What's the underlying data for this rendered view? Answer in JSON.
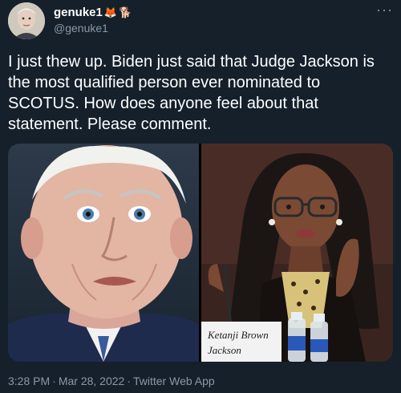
{
  "tweet": {
    "display_name": "genuke1",
    "name_emojis": [
      "fox-icon",
      "dog-icon"
    ],
    "handle": "@genuke1",
    "more_label": "···",
    "text": "I just thew up. Biden just said that Judge Jackson is the most qualified person ever nominated to SCOTUS. How does anyone feel about that statement. Please comment.",
    "photos": [
      {
        "id": "left",
        "subject": "man-face-photo"
      },
      {
        "id": "right",
        "subject": "woman-speaking-photo",
        "nameplate_line1": "Ketanji Brown",
        "nameplate_line2": "Jackson"
      }
    ],
    "time": "3:28 PM",
    "date": "Mar 28, 2022",
    "separator": "·",
    "source": "Twitter Web App"
  },
  "colors": {
    "background": "#15202b",
    "text_primary": "#ffffff",
    "text_secondary": "#8b98a5"
  }
}
